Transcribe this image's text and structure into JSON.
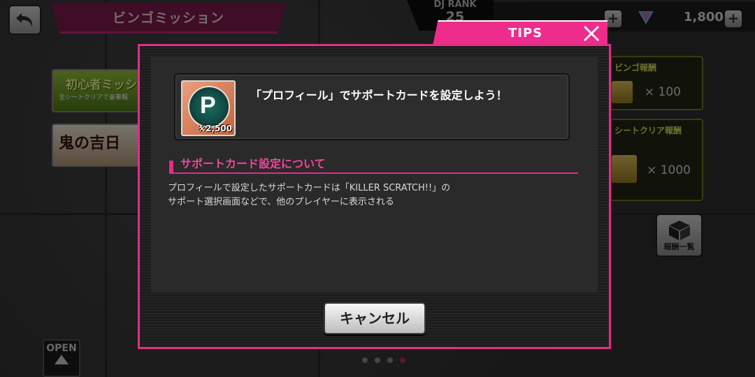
{
  "header": {
    "title": "ビンゴミッション",
    "dj_rank_label": "DJ RANK",
    "dj_rank_value": "25",
    "gem_amount": "1,800"
  },
  "missions": {
    "beginner_banner_title": "初心者ミッシ",
    "beginner_banner_sub": "全シートクリアで豪華報",
    "event_banner_title": "鬼の吉日"
  },
  "rewards": {
    "bingo_reward_head": "ビンゴ報酬",
    "bingo_reward_amount": "× 100",
    "sheet_clear_head": "シートクリア報酬",
    "sheet_clear_amount": "× 1000",
    "reward_list_label": "報酬一覧"
  },
  "open_button": {
    "label": "OPEN"
  },
  "tips": {
    "tab_label": "TIPS",
    "card_title": "「プロフィール」でサポートカードを設定しよう！",
    "item_quantity": "×2,500",
    "item_coin_letter": "P",
    "section_title": "サポートカード設定について",
    "description_line1": "プロフィールで設定したサポートカードは「KILLER SCRATCH!!」の",
    "description_line2": "サポート選択画面などで、他のプレイヤーに表示される",
    "cancel_label": "キャンセル"
  },
  "pagination": {
    "total": 4,
    "active_index": 3
  },
  "colors": {
    "accent": "#e22d89",
    "tab_pink": "#ee2c8c",
    "section_text": "#f0479b"
  }
}
